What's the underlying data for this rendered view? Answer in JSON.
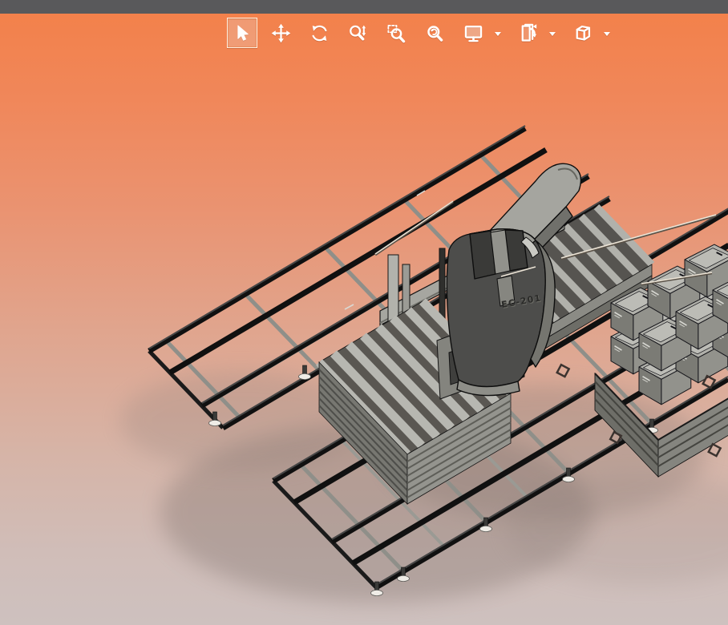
{
  "titlebar": {
    "color": "#59595B"
  },
  "viewport": {
    "background_top": "#F3814B",
    "background_bottom": "#CEC1BF",
    "shadow_color": "#8A7D78"
  },
  "toolbar": {
    "icon_color": "#FFFFFF",
    "active_tool": "select",
    "tools": [
      {
        "name": "select",
        "icon": "cursor-icon",
        "active": true,
        "has_dropdown": false
      },
      {
        "name": "pan",
        "icon": "move-arrows-icon",
        "active": false,
        "has_dropdown": false
      },
      {
        "name": "rotate",
        "icon": "rotate-arrows-icon",
        "active": false,
        "has_dropdown": false
      },
      {
        "name": "zoom-in-out",
        "icon": "magnifier-updown-icon",
        "active": false,
        "has_dropdown": false
      },
      {
        "name": "zoom-to-area",
        "icon": "magnifier-dashed-box-icon",
        "active": false,
        "has_dropdown": false
      },
      {
        "name": "zoom-to-fit",
        "icon": "magnifier-circle-icon",
        "active": false,
        "has_dropdown": false
      },
      {
        "name": "display-options",
        "icon": "monitor-icon",
        "active": false,
        "has_dropdown": true
      },
      {
        "name": "model-views",
        "icon": "sheet-arrow-icon",
        "active": false,
        "has_dropdown": true
      },
      {
        "name": "view-orientation",
        "icon": "cube-icon",
        "active": false,
        "has_dropdown": true
      }
    ]
  },
  "scene": {
    "machine_label": "EC-201",
    "objects": [
      "conveyor-rail-frame",
      "gantry",
      "strapping-machine-head",
      "discharge-chute-arm",
      "pallet-stack",
      "loaded-pallet-with-crates",
      "leveling-feet"
    ],
    "colors": {
      "rail_black": "#181818",
      "steel_gray": "#A6A6A0",
      "machine_cover_dark": "#4D4D4B",
      "pallet_gray": "#B5B5B0"
    }
  }
}
